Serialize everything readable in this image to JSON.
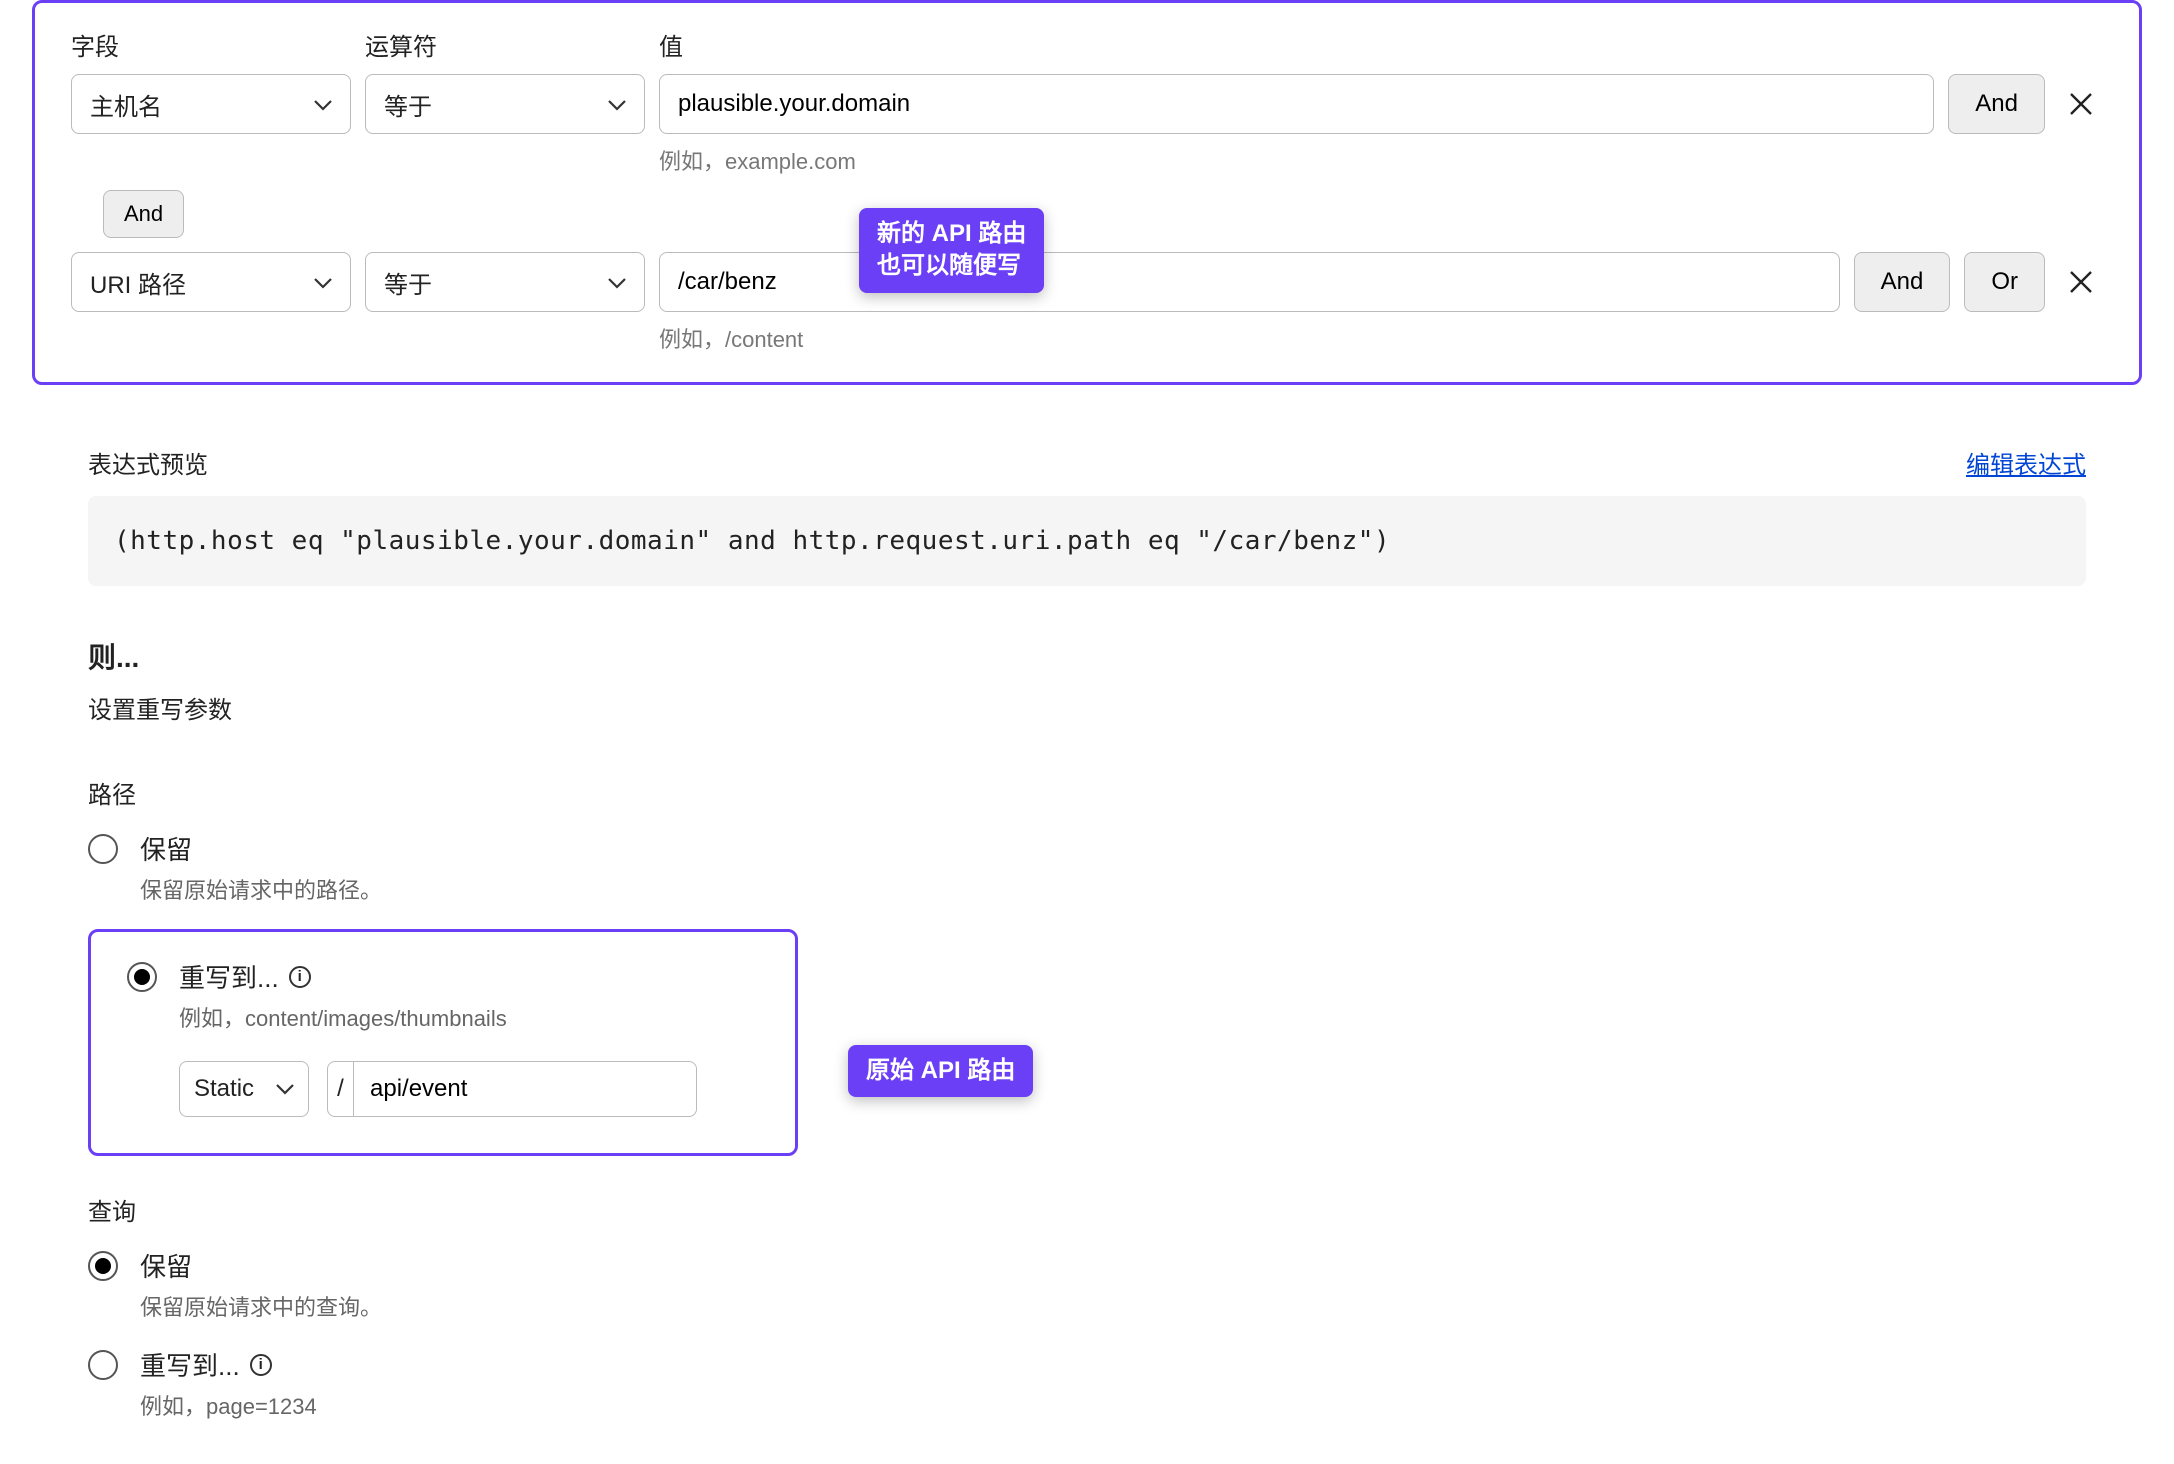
{
  "headers": {
    "field": "字段",
    "operator": "运算符",
    "value": "值"
  },
  "rows": [
    {
      "field": "主机名",
      "operator": "等于",
      "value": "plausible.your.domain",
      "hint": "例如，example.com",
      "buttons": [
        "And"
      ]
    },
    {
      "field": "URI 路径",
      "operator": "等于",
      "value": "/car/benz",
      "hint": "例如，/content",
      "buttons": [
        "And",
        "Or"
      ]
    }
  ],
  "connector": "And",
  "badge1": "新的 API 路由\n也可以随便写",
  "badge2": "原始 API 路由",
  "preview": {
    "title": "表达式预览",
    "edit": "编辑表达式",
    "code": "(http.host eq \"plausible.your.domain\" and http.request.uri.path eq \"/car/benz\")"
  },
  "then": {
    "title": "则...",
    "sub": "设置重写参数"
  },
  "path": {
    "label": "路径",
    "preserve": {
      "title": "保留",
      "sub": "保留原始请求中的路径。"
    },
    "rewrite": {
      "title": "重写到...",
      "sub": "例如，content/images/thumbnails",
      "mode": "Static",
      "prefix": "/",
      "value": "api/event"
    }
  },
  "query": {
    "label": "查询",
    "preserve": {
      "title": "保留",
      "sub": "保留原始请求中的查询。"
    },
    "rewrite": {
      "title": "重写到...",
      "sub": "例如，page=1234"
    }
  }
}
